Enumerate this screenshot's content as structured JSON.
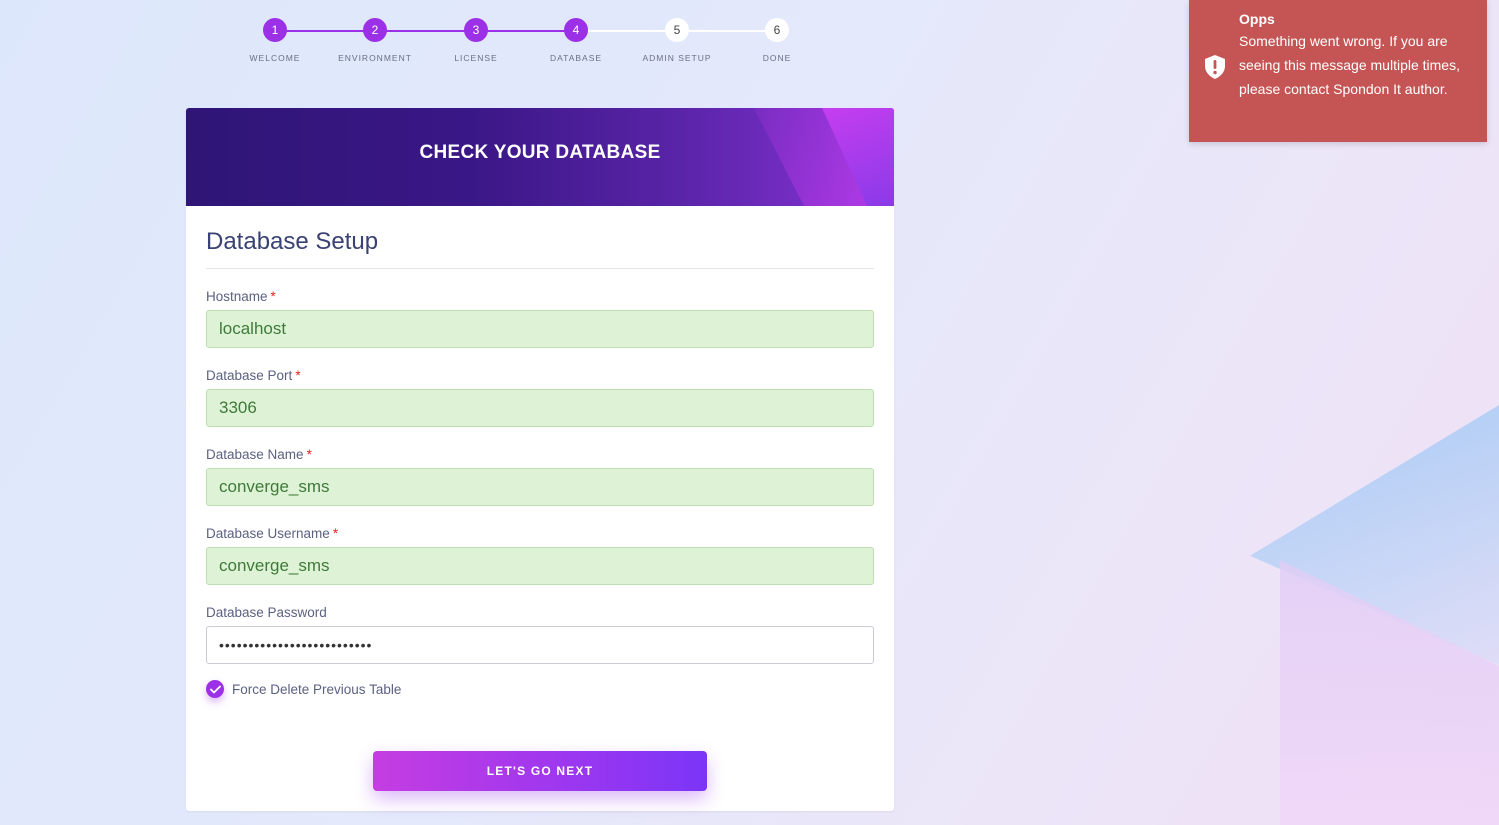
{
  "stepper": {
    "steps": [
      {
        "number": "1",
        "label": "WELCOME",
        "state": "done"
      },
      {
        "number": "2",
        "label": "ENVIRONMENT",
        "state": "done"
      },
      {
        "number": "3",
        "label": "LICENSE",
        "state": "done"
      },
      {
        "number": "4",
        "label": "DATABASE",
        "state": "done"
      },
      {
        "number": "5",
        "label": "ADMIN SETUP",
        "state": "todo"
      },
      {
        "number": "6",
        "label": "DONE",
        "state": "todo"
      }
    ],
    "active_color": "#9b30e6"
  },
  "card": {
    "header_title": "CHECK YOUR DATABASE",
    "section_title": "Database Setup",
    "fields": {
      "hostname": {
        "label": "Hostname",
        "value": "localhost",
        "required": "*"
      },
      "port": {
        "label": "Database Port",
        "value": "3306",
        "required": "*"
      },
      "name": {
        "label": "Database Name",
        "value": "converge_sms",
        "required": "*"
      },
      "username": {
        "label": "Database Username",
        "value": "converge_sms",
        "required": "*"
      },
      "password": {
        "label": "Database Password",
        "value": "••••••••••••••••••••••••••"
      }
    },
    "force_delete_label": "Force Delete Previous Table",
    "force_delete_checked": true,
    "submit_label": "LET'S GO NEXT"
  },
  "toast": {
    "title": "Opps",
    "message": "Something went wrong. If you are seeing this message multiple times, please contact Spondon It author.",
    "icon": "shield-exclamation-icon",
    "color": "#c55554"
  }
}
